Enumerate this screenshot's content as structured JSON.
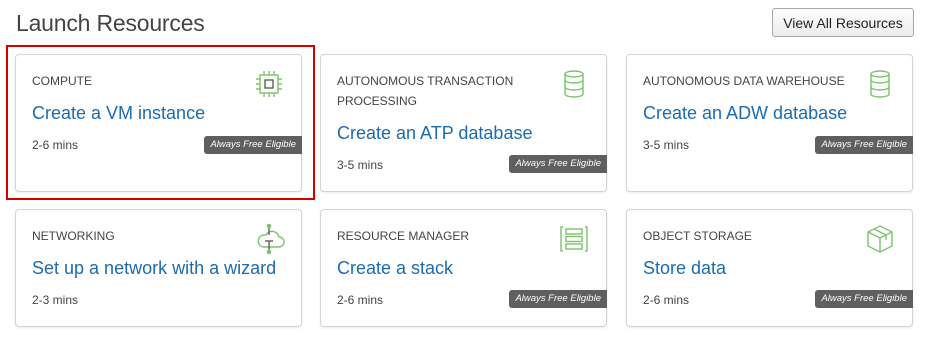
{
  "header": {
    "title": "Launch Resources",
    "view_all_label": "View All Resources"
  },
  "badge_label": "Always Free Eligible",
  "colors": {
    "link": "#1b6bb3",
    "icon_green": "#7cc36e",
    "highlight": "#d40000",
    "badge_bg": "#5f5f5f"
  },
  "cards": [
    {
      "category": "COMPUTE",
      "action": "Create a VM instance",
      "duration": "2-6 mins",
      "icon": "chip-icon",
      "badge": true
    },
    {
      "category": "AUTONOMOUS TRANSACTION PROCESSING",
      "action": "Create an ATP database",
      "duration": "3-5 mins",
      "icon": "database-icon",
      "badge": true
    },
    {
      "category": "AUTONOMOUS DATA WAREHOUSE",
      "action": "Create an ADW database",
      "duration": "3-5 mins",
      "icon": "database-icon",
      "badge": true
    },
    {
      "category": "NETWORKING",
      "action": "Set up a network with a wizard",
      "duration": "2-3 mins",
      "icon": "network-cloud-icon",
      "badge": false
    },
    {
      "category": "RESOURCE MANAGER",
      "action": "Create a stack",
      "duration": "2-6 mins",
      "icon": "stack-icon",
      "badge": true
    },
    {
      "category": "OBJECT STORAGE",
      "action": "Store data",
      "duration": "2-6 mins",
      "icon": "box-icon",
      "badge": true
    }
  ]
}
